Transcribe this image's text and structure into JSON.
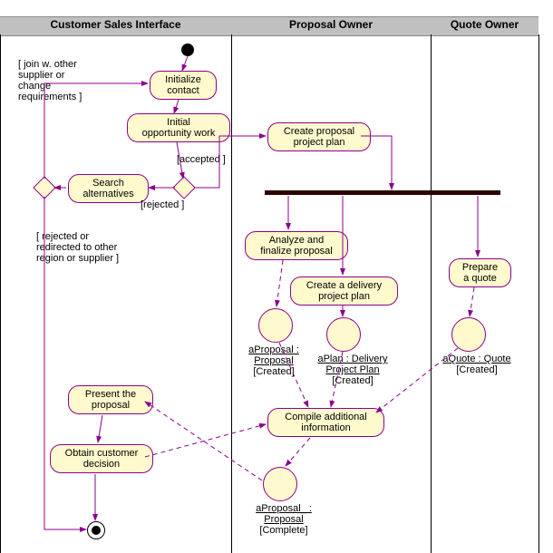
{
  "lanes": {
    "l1": "Customer Sales Interface",
    "l2": "Proposal Owner",
    "l3": "Quote Owner"
  },
  "activities": {
    "initContact": "Initialize\ncontact",
    "initOpp": "Initial\nopportunity work",
    "searchAlt": "Search\nalternatives",
    "createPP": "Create proposal\nproject plan",
    "analyze": "Analyze and\nfinalize proposal",
    "createDP": "Create a delivery\nproject plan",
    "prepQuote": "Prepare\na quote",
    "compile": "Compile additional\ninformation",
    "present": "Present the\nproposal",
    "obtain": "Obtain customer\ndecision"
  },
  "objects": {
    "aProposal": {
      "name": "aProposal :\nProposal",
      "state": "[Created]"
    },
    "aPlan": {
      "name": "aPlan : Delivery\nProject Plan",
      "state": "[Created]"
    },
    "aQuote": {
      "name": "aQuote : Quote",
      "state": "[Created]"
    },
    "aProposal2": {
      "name": "aProposal_ :\nProposal",
      "state": "[Complete]"
    }
  },
  "guards": {
    "join": "[ join w. other\nsupplier or\nchange\nrequirements ]",
    "accepted": "[accepted ]",
    "rejected": "[rejected ]",
    "redirected": "[ rejected or\nredirected to other\nregion or supplier ]"
  }
}
